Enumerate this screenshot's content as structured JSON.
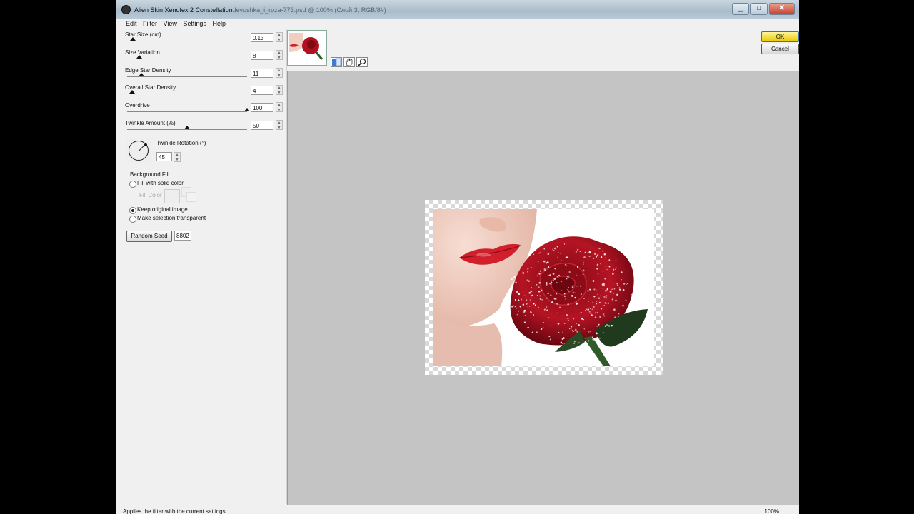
{
  "window": {
    "title": "Alien Skin Xenofex 2 Constellation",
    "document_title": "devushka_i_roza-773.psd @ 100% (Слой 3, RGB/8#)",
    "minimize": "▁",
    "maximize": "□",
    "close": "✕"
  },
  "menu": [
    "Edit",
    "Filter",
    "View",
    "Settings",
    "Help"
  ],
  "params": [
    {
      "label": "Star Size (cm)",
      "value": "0.13",
      "level": 0.05
    },
    {
      "label": "Size Variation",
      "value": "8",
      "level": 0.1
    },
    {
      "label": "Edge Star Density",
      "value": "11",
      "level": 0.12
    },
    {
      "label": "Overall Star Density",
      "value": "4",
      "level": 0.04
    },
    {
      "label": "Overdrive",
      "value": "100",
      "level": 1.0
    },
    {
      "label": "Twinkle Amount (%)",
      "value": "50",
      "level": 0.5
    }
  ],
  "twinkle_rotation": {
    "label": "Twinkle Rotation (°)",
    "value": "45"
  },
  "background_fill": {
    "title": "Background Fill",
    "options": [
      {
        "label": "Fill with solid color",
        "selected": false
      },
      {
        "label": "Keep original image",
        "selected": true
      },
      {
        "label": "Make selection transparent",
        "selected": false
      }
    ],
    "fill_color_label": "Fill Color"
  },
  "random_seed": {
    "button": "Random Seed",
    "value": "8802"
  },
  "buttons": {
    "ok": "OK",
    "cancel": "Cancel"
  },
  "status": {
    "text": "Applies the filter with the current settings",
    "zoom": "100%"
  },
  "colors": {
    "accent": "#e9c800",
    "rose": "#b01020"
  },
  "icons": [
    "hand-icon",
    "zoom-icon",
    "compare-icon"
  ]
}
